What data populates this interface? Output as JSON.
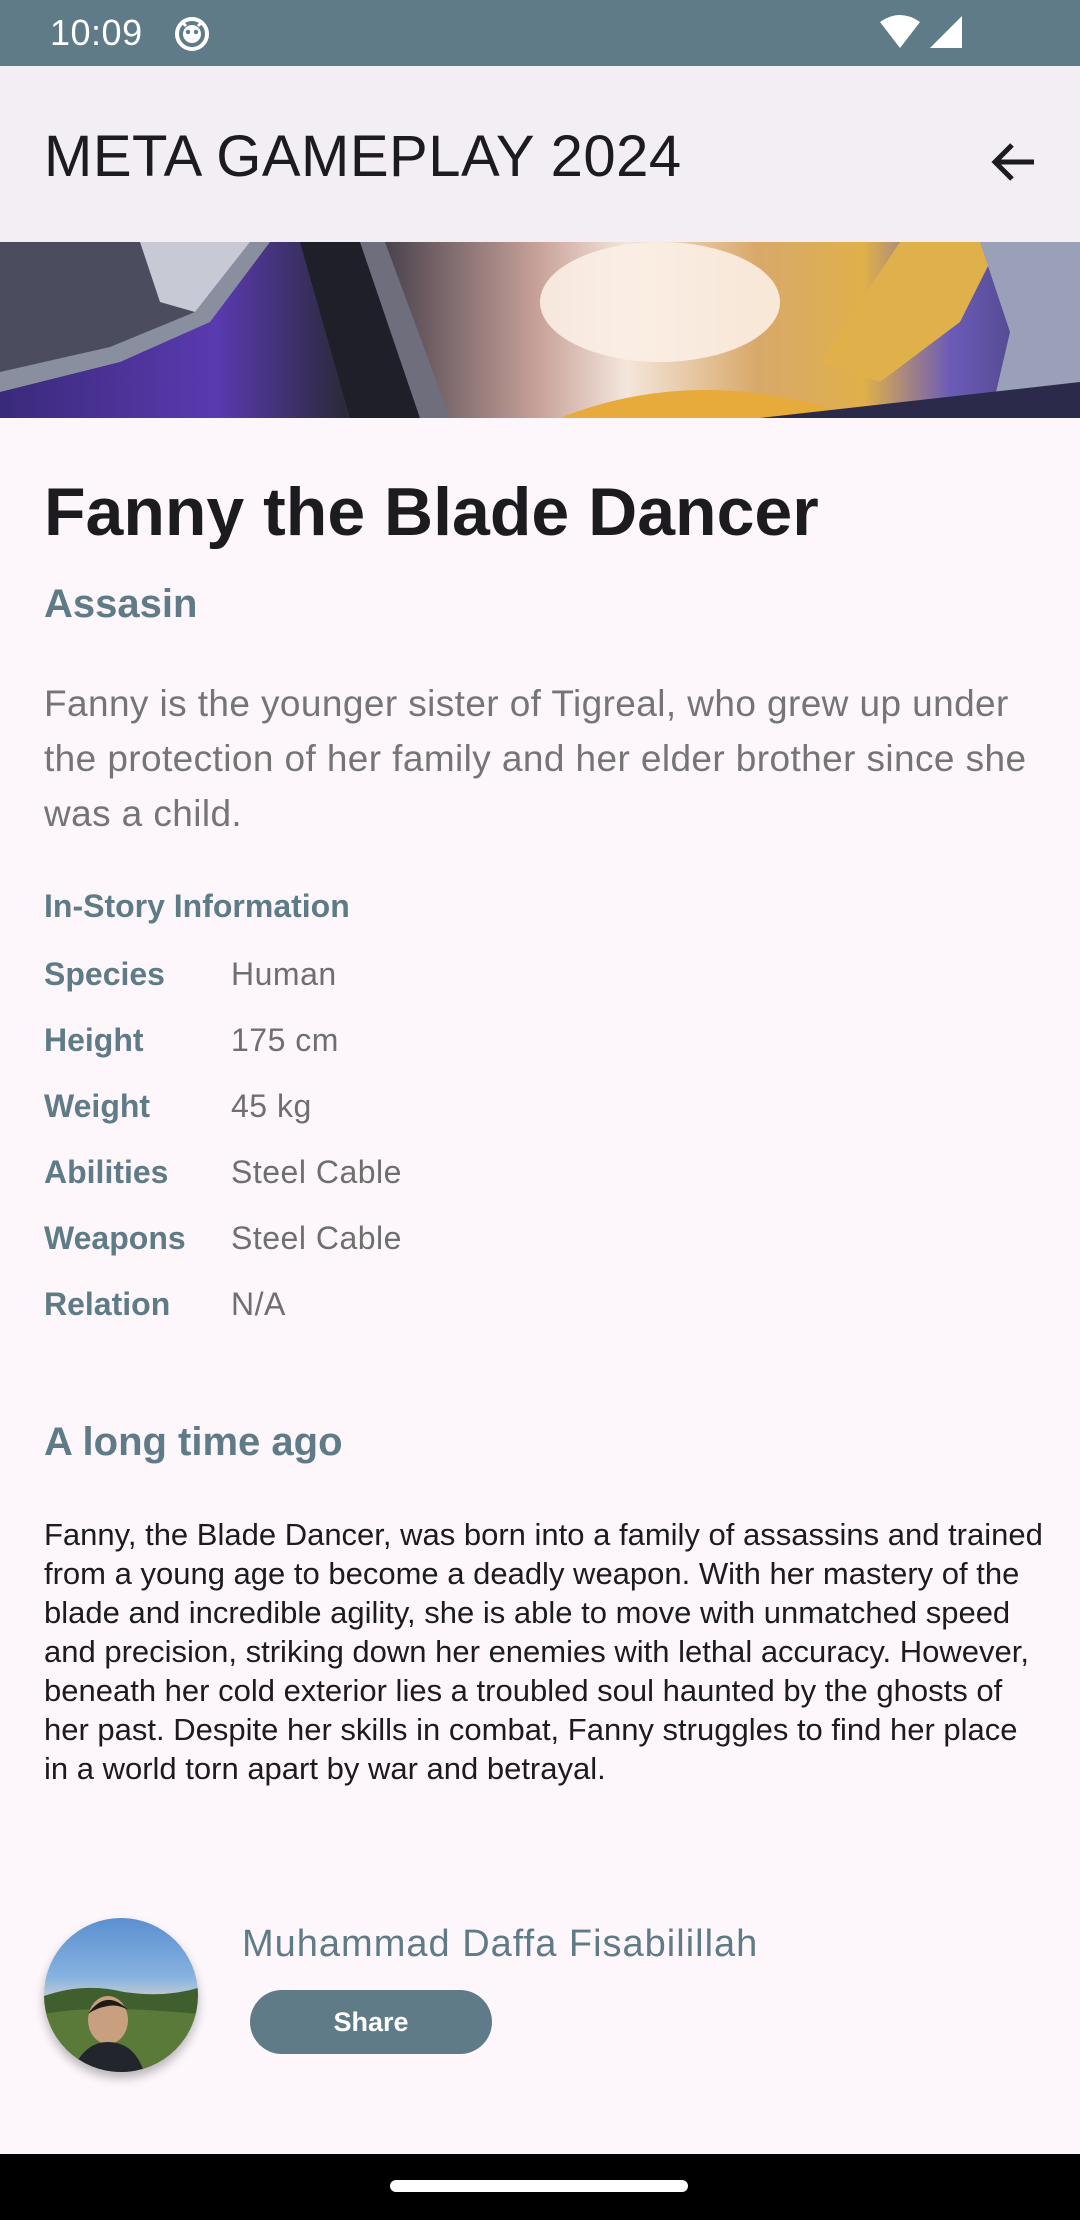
{
  "status_bar": {
    "time": "10:09",
    "icons": [
      "notification-icon",
      "wifi-icon",
      "signal-icon"
    ]
  },
  "app_bar": {
    "title": "META GAMEPLAY 2024",
    "back_icon": "arrow-back-icon"
  },
  "hero": {
    "name": "Fanny the Blade Dancer",
    "role": "Assasin",
    "summary": "Fanny is the younger sister of Tigreal, who grew up under the protection of her family and her elder brother since she was a child."
  },
  "info": {
    "heading": "In-Story Information",
    "rows": [
      {
        "label": "Species",
        "value": "Human"
      },
      {
        "label": "Height",
        "value": "175 cm"
      },
      {
        "label": "Weight",
        "value": "45 kg"
      },
      {
        "label": "Abilities",
        "value": "Steel Cable"
      },
      {
        "label": "Weapons",
        "value": "Steel Cable"
      },
      {
        "label": "Relation",
        "value": "N/A"
      }
    ]
  },
  "story": {
    "heading": "A long time ago",
    "text": "Fanny, the Blade Dancer, was born into a family of assassins and trained from a young age to become a deadly weapon. With her mastery of the blade and incredible agility, she is able to move with unmatched speed and precision, striking down her enemies with lethal accuracy. However, beneath her cold exterior lies a troubled soul haunted by the ghosts of her past. Despite her skills in combat, Fanny struggles to find her place in a world torn apart by war and betrayal."
  },
  "author": {
    "name": "Muhammad Daffa Fisabilillah",
    "share_label": "Share"
  },
  "colors": {
    "accent": "#5f7b87",
    "background": "#fdf7fc",
    "app_bar": "#f3edf4"
  }
}
